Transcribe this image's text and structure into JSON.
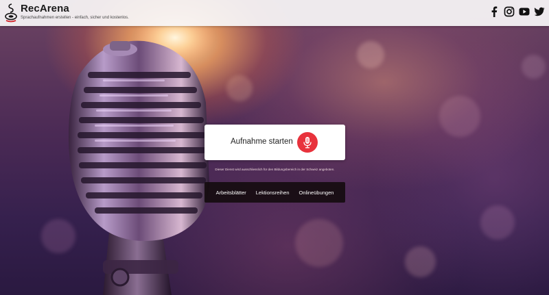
{
  "header": {
    "title": "RecArena",
    "tagline": "Sprachaufnahmen erstellen - einfach, sicher und kostenlos.",
    "social_icons": [
      "facebook-icon",
      "instagram-icon",
      "youtube-icon",
      "twitter-icon"
    ]
  },
  "recorder": {
    "start_label": "Aufnahme starten",
    "button_icon": "microphone-icon",
    "button_color": "#e8323c"
  },
  "notice": "Dieser Dienst wird ausschliesslich für den Bildungsbereich in der Schweiz angeboten.",
  "nav": {
    "items": [
      {
        "label": "Arbeitsblätter"
      },
      {
        "label": "Lektionsreihen"
      },
      {
        "label": "Onlineübungen"
      }
    ]
  },
  "colors": {
    "header_bg": "#f8f6f7",
    "accent_red": "#e8323c",
    "nav_bg": "#120a0c"
  }
}
